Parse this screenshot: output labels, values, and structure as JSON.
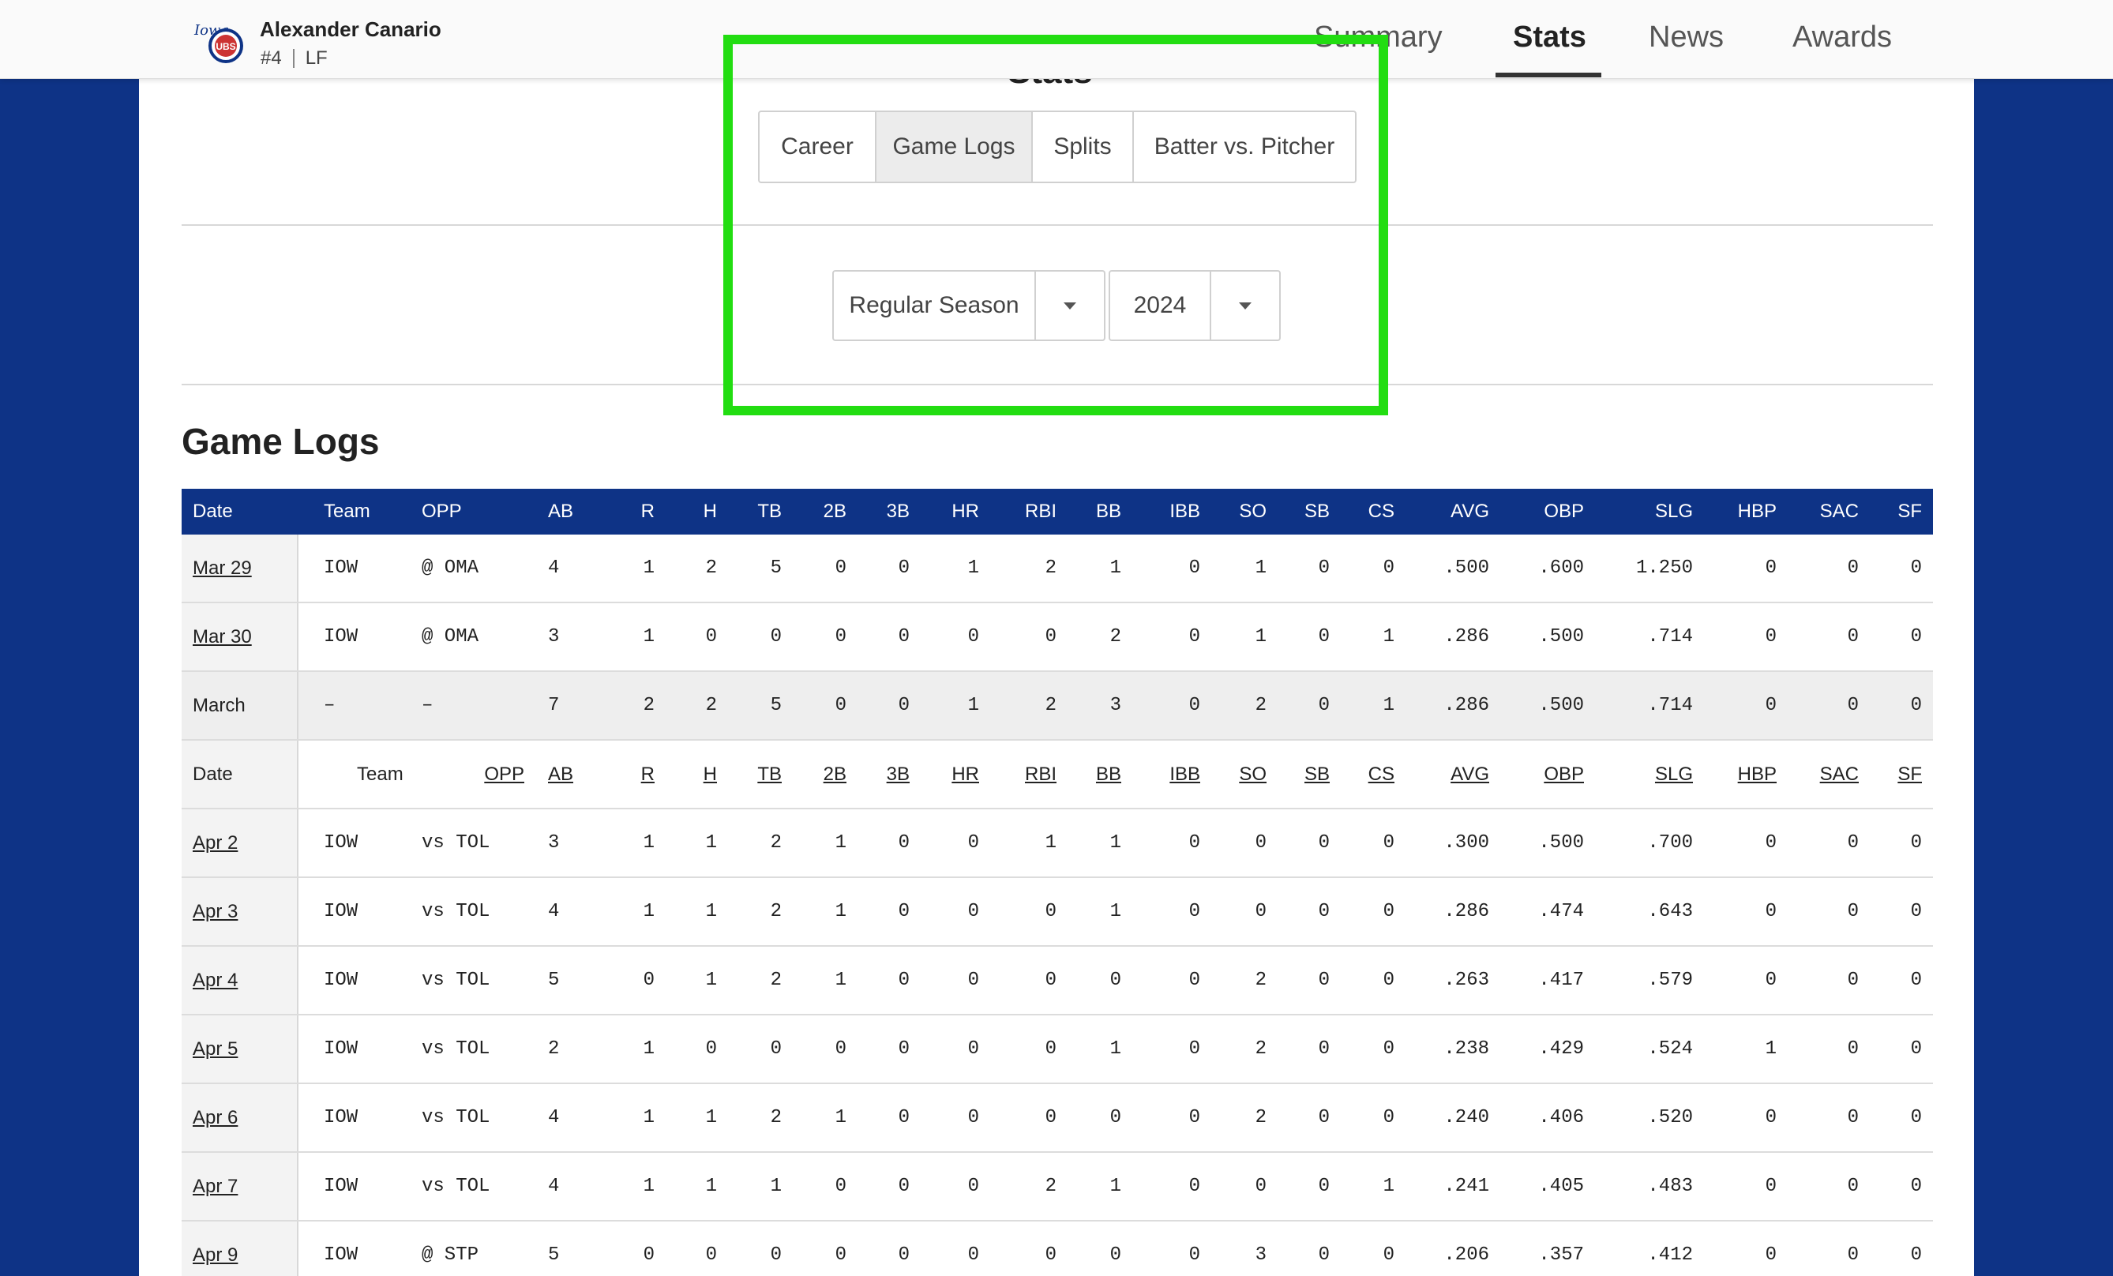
{
  "player": {
    "name": "Alexander Canario",
    "number": "#4",
    "position": "LF",
    "logo": "iowa-cubs-logo"
  },
  "nav": {
    "items": [
      "Summary",
      "Stats",
      "News",
      "Awards"
    ],
    "active": "Stats"
  },
  "stats_title": "Stats",
  "tabs": {
    "items": [
      "Career",
      "Game Logs",
      "Splits",
      "Batter vs. Pitcher"
    ],
    "active": "Game Logs"
  },
  "filters": {
    "season_type": "Regular Season",
    "year": "2024"
  },
  "section_title": "Game Logs",
  "colors": {
    "brand_blue": "#0e3386",
    "highlight": "#22dd11"
  },
  "table": {
    "columns": [
      "Date",
      "Team",
      "OPP",
      "AB",
      "R",
      "H",
      "TB",
      "2B",
      "3B",
      "HR",
      "RBI",
      "BB",
      "IBB",
      "SO",
      "SB",
      "CS",
      "AVG",
      "OBP",
      "SLG",
      "HBP",
      "SAC",
      "SF"
    ],
    "rows": [
      {
        "kind": "game",
        "cells": [
          "Mar 29",
          "IOW",
          "@ OMA",
          "4",
          "1",
          "2",
          "5",
          "0",
          "0",
          "1",
          "2",
          "1",
          "0",
          "1",
          "0",
          "0",
          ".500",
          ".600",
          "1.250",
          "0",
          "0",
          "0"
        ]
      },
      {
        "kind": "game",
        "cells": [
          "Mar 30",
          "IOW",
          "@ OMA",
          "3",
          "1",
          "0",
          "0",
          "0",
          "0",
          "0",
          "0",
          "2",
          "0",
          "1",
          "0",
          "1",
          ".286",
          ".500",
          ".714",
          "0",
          "0",
          "0"
        ]
      },
      {
        "kind": "monthly",
        "cells": [
          "March",
          "–",
          "–",
          "7",
          "2",
          "2",
          "5",
          "0",
          "0",
          "1",
          "2",
          "3",
          "0",
          "2",
          "0",
          "1",
          ".286",
          ".500",
          ".714",
          "0",
          "0",
          "0"
        ]
      },
      {
        "kind": "subhead",
        "cells": [
          "Date",
          "Team",
          "OPP",
          "AB",
          "R",
          "H",
          "TB",
          "2B",
          "3B",
          "HR",
          "RBI",
          "BB",
          "IBB",
          "SO",
          "SB",
          "CS",
          "AVG",
          "OBP",
          "SLG",
          "HBP",
          "SAC",
          "SF"
        ]
      },
      {
        "kind": "game",
        "cells": [
          "Apr 2",
          "IOW",
          "vs TOL",
          "3",
          "1",
          "1",
          "2",
          "1",
          "0",
          "0",
          "1",
          "1",
          "0",
          "0",
          "0",
          "0",
          ".300",
          ".500",
          ".700",
          "0",
          "0",
          "0"
        ]
      },
      {
        "kind": "game",
        "cells": [
          "Apr 3",
          "IOW",
          "vs TOL",
          "4",
          "1",
          "1",
          "2",
          "1",
          "0",
          "0",
          "0",
          "1",
          "0",
          "0",
          "0",
          "0",
          ".286",
          ".474",
          ".643",
          "0",
          "0",
          "0"
        ]
      },
      {
        "kind": "game",
        "cells": [
          "Apr 4",
          "IOW",
          "vs TOL",
          "5",
          "0",
          "1",
          "2",
          "1",
          "0",
          "0",
          "0",
          "0",
          "0",
          "2",
          "0",
          "0",
          ".263",
          ".417",
          ".579",
          "0",
          "0",
          "0"
        ]
      },
      {
        "kind": "game",
        "cells": [
          "Apr 5",
          "IOW",
          "vs TOL",
          "2",
          "1",
          "0",
          "0",
          "0",
          "0",
          "0",
          "0",
          "1",
          "0",
          "2",
          "0",
          "0",
          ".238",
          ".429",
          ".524",
          "1",
          "0",
          "0"
        ]
      },
      {
        "kind": "game",
        "cells": [
          "Apr 6",
          "IOW",
          "vs TOL",
          "4",
          "1",
          "1",
          "2",
          "1",
          "0",
          "0",
          "0",
          "0",
          "0",
          "2",
          "0",
          "0",
          ".240",
          ".406",
          ".520",
          "0",
          "0",
          "0"
        ]
      },
      {
        "kind": "game",
        "cells": [
          "Apr 7",
          "IOW",
          "vs TOL",
          "4",
          "1",
          "1",
          "1",
          "0",
          "0",
          "0",
          "2",
          "1",
          "0",
          "0",
          "0",
          "1",
          ".241",
          ".405",
          ".483",
          "0",
          "0",
          "0"
        ]
      },
      {
        "kind": "game",
        "cells": [
          "Apr 9",
          "IOW",
          "@ STP",
          "5",
          "0",
          "0",
          "0",
          "0",
          "0",
          "0",
          "0",
          "0",
          "0",
          "3",
          "0",
          "0",
          ".206",
          ".357",
          ".412",
          "0",
          "0",
          "0"
        ]
      }
    ]
  }
}
